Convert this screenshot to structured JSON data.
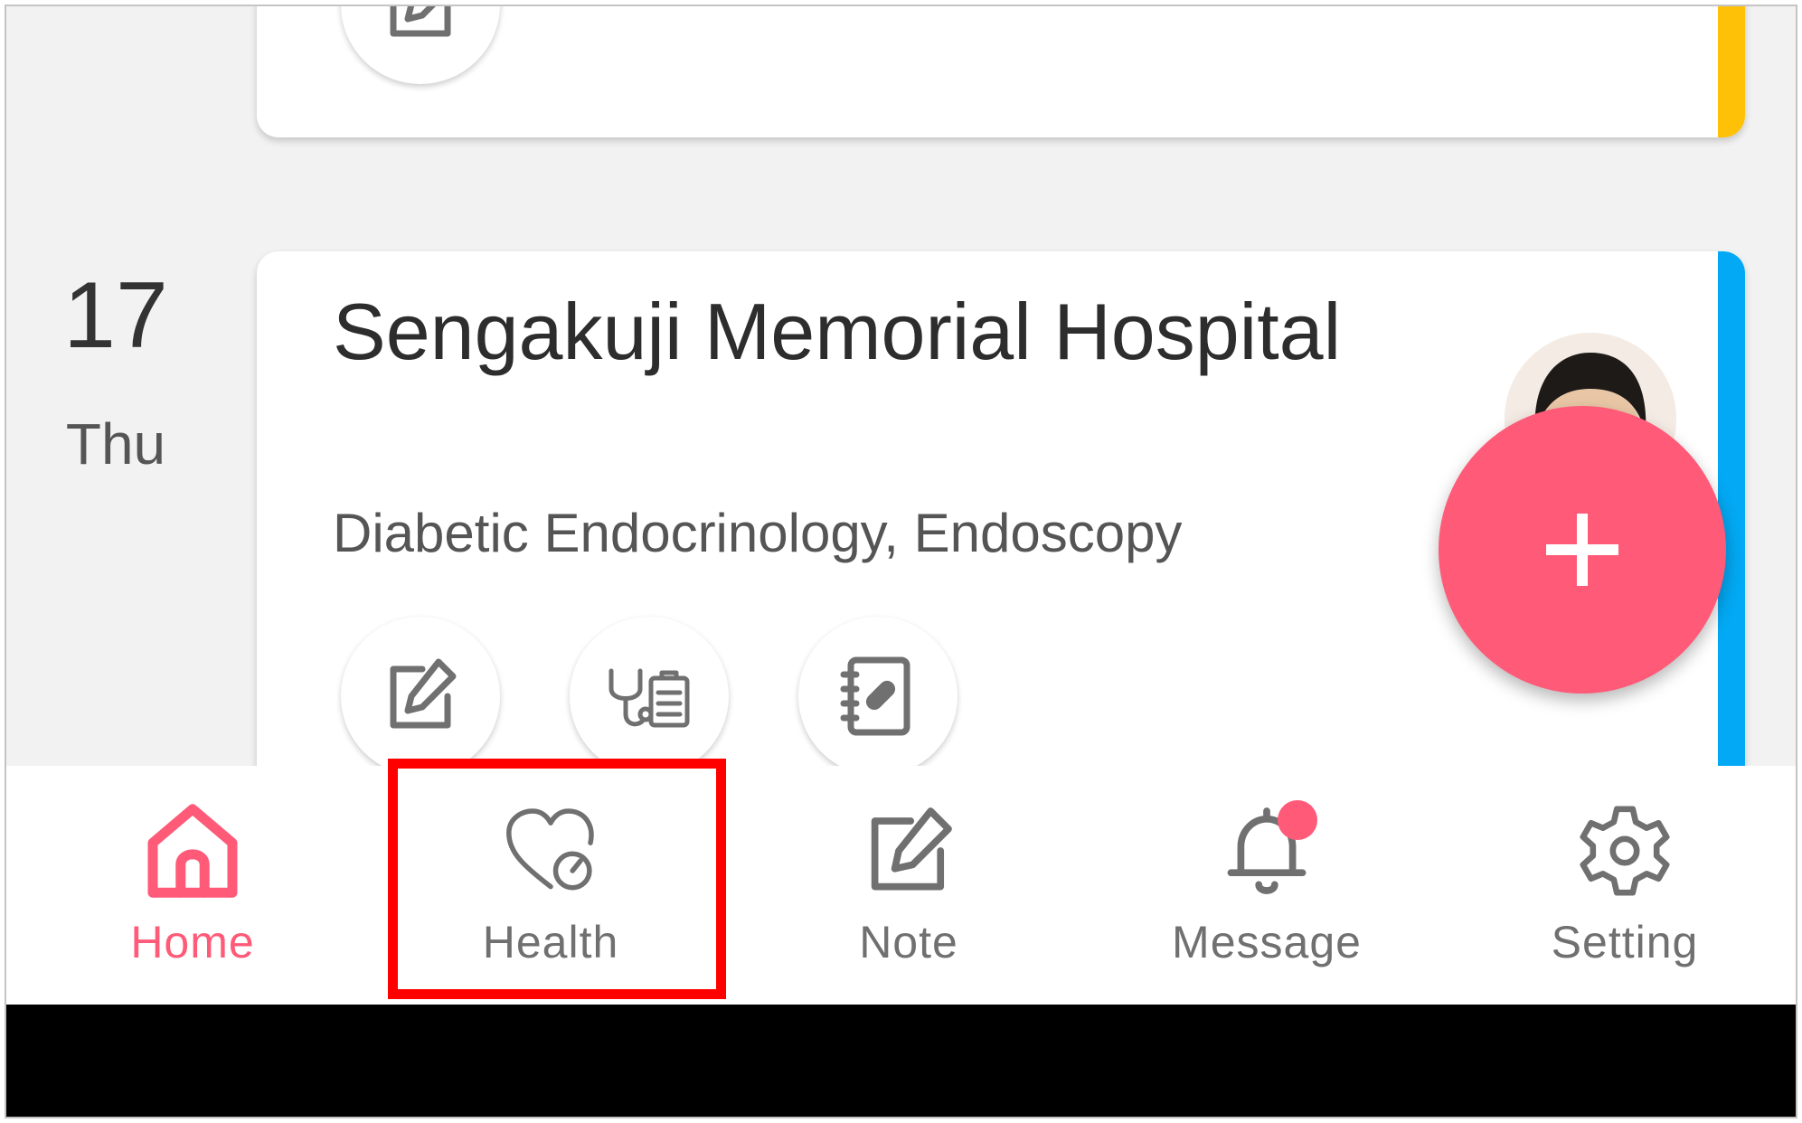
{
  "colors": {
    "accent": "#ff5a78",
    "nav_inactive": "#707070",
    "icon_gray": "#707070",
    "prev_card_stripe": "#ffc107",
    "main_card_stripe": "#03a9f4",
    "highlight": "#ff0000"
  },
  "appointment": {
    "date_day": "17",
    "date_weekday": "Thu",
    "hospital_name": "Sengakuji Memorial Hospital",
    "department": "Diabetic Endocrinology, Endoscopy",
    "actions": [
      {
        "icon": "edit-note-icon"
      },
      {
        "icon": "stethoscope-clipboard-icon"
      },
      {
        "icon": "medicine-notebook-icon"
      }
    ],
    "avatar": "doctor-avatar"
  },
  "fab": {
    "icon": "plus-icon"
  },
  "bottom_nav": {
    "items": [
      {
        "label": "Home",
        "icon": "home-icon",
        "active": true
      },
      {
        "label": "Health",
        "icon": "heart-health-icon",
        "active": false
      },
      {
        "label": "Note",
        "icon": "note-edit-icon",
        "active": false
      },
      {
        "label": "Message",
        "icon": "bell-icon",
        "active": false,
        "has_notification": true
      },
      {
        "label": "Setting",
        "icon": "gear-icon",
        "active": false
      }
    ]
  }
}
